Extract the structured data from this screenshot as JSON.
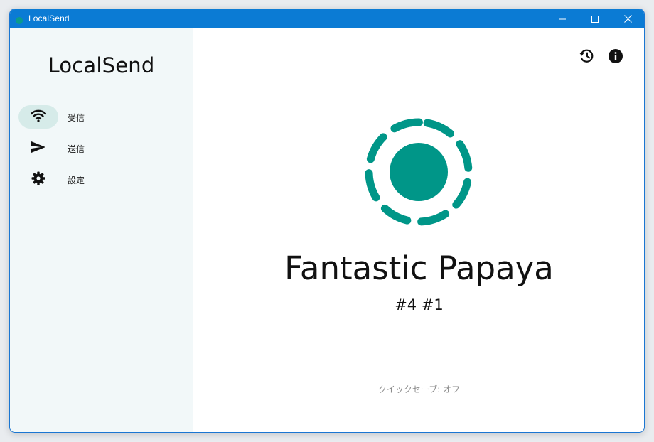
{
  "window": {
    "title": "LocalSend",
    "controls": {
      "minimize_icon": "minimize-icon",
      "maximize_icon": "maximize-icon",
      "close_icon": "close-icon"
    }
  },
  "sidebar": {
    "brand": "LocalSend",
    "items": [
      {
        "label": "受信",
        "icon": "wifi-icon",
        "active": true
      },
      {
        "label": "送信",
        "icon": "send-icon",
        "active": false
      },
      {
        "label": "設定",
        "icon": "gear-icon",
        "active": false
      }
    ]
  },
  "main": {
    "actions": {
      "history_icon": "history-icon",
      "info_icon": "info-icon"
    },
    "device_name": "Fantastic Papaya",
    "device_id": "#4 #1",
    "quick_save": "クイックセーブ: オフ"
  },
  "colors": {
    "accent": "#009688",
    "titlebar": "#0b7bd4",
    "sidebar_bg": "#f2f8f9",
    "active_pill": "#d6ebe9"
  }
}
